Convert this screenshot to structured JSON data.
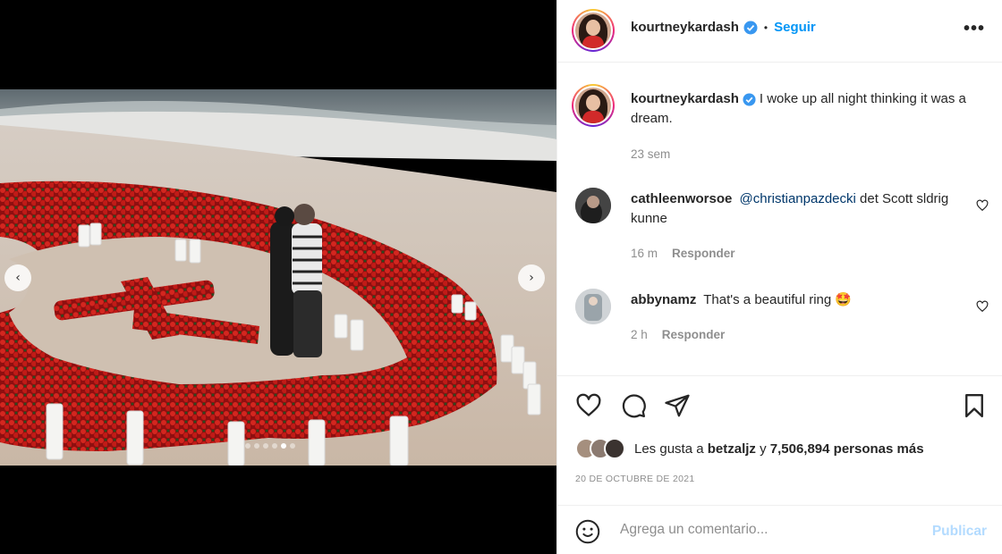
{
  "post": {
    "username": "kourtneykardash",
    "follow_label": "Seguir",
    "separator": "•",
    "more_label": "•••"
  },
  "caption": {
    "username": "kourtneykardash",
    "text": "I woke up all night thinking it was a dream.",
    "time": "23 sem"
  },
  "comments": [
    {
      "username": "cathleenworsoe",
      "mention": "@christianpazdecki",
      "text": " det Scott sldrig kunne",
      "time": "16 m",
      "reply_label": "Responder"
    },
    {
      "username": "abbynamz",
      "mention": "",
      "text": "That's a beautiful ring 🤩",
      "time": "2 h",
      "reply_label": "Responder"
    }
  ],
  "likes": {
    "prefix": "Les gusta a ",
    "first_user": "betzaljz",
    "middle": " y ",
    "count": "7,506,894 personas más"
  },
  "date": "20 DE OCTUBRE DE 2021",
  "comment_box": {
    "placeholder": "Agrega un comentario...",
    "publish_label": "Publicar"
  },
  "carousel": {
    "prev_label": "‹",
    "next_label": "›",
    "slide_count": 6,
    "active_slide": 5
  },
  "colors": {
    "link_blue": "#0095f6",
    "publish_disabled": "#b3dbff",
    "muted_text": "#8e8e8e",
    "rose_red": "#c41a1a"
  }
}
